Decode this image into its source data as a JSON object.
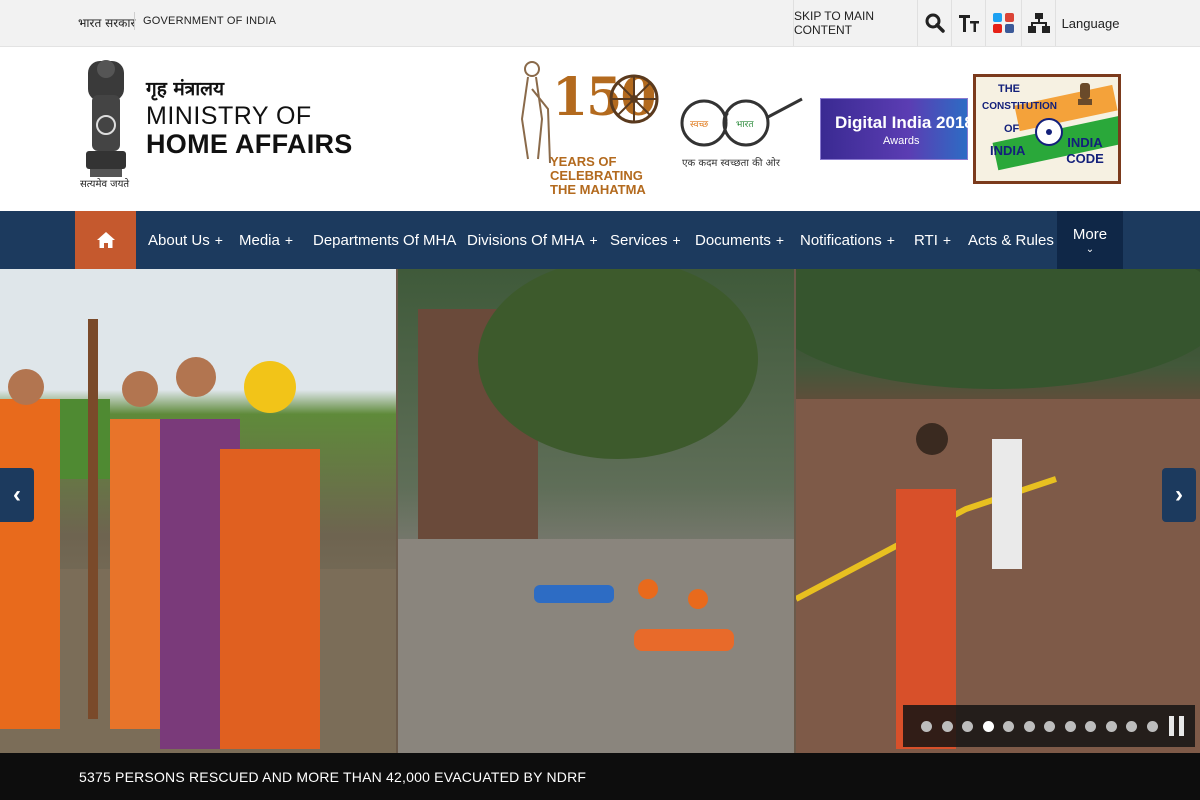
{
  "topbar": {
    "gov_hindi": "भारत सरकार",
    "gov_english": "GOVERNMENT OF INDIA",
    "skip_label": "SKIP TO MAIN CONTENT",
    "language_label": "Language"
  },
  "header": {
    "emblem_motto": "सत्यमेव जयते",
    "ministry_hindi": "गृह मंत्रालय",
    "ministry_line1": "MINISTRY OF",
    "ministry_line2": "HOME AFFAIRS",
    "gandhi_number": "150",
    "gandhi_caption": "YEARS OF CELEBRATING THE MAHATMA",
    "swachh_left": "स्वच्छ",
    "swachh_right": "भारत",
    "swachh_tagline": "एक कदम स्वच्छता की ओर",
    "digital_india": "Digital India 2018",
    "digital_awards": "Awards",
    "constitution_the": "THE",
    "constitution_name": "CONSTITUTION",
    "constitution_of": "OF",
    "constitution_india": "INDIA",
    "india_code": "INDIA CODE"
  },
  "nav": {
    "items": [
      {
        "label": "About Us",
        "plus": "+"
      },
      {
        "label": "Media",
        "plus": "+"
      },
      {
        "label": "Departments Of MHA",
        "plus": ""
      },
      {
        "label": "Divisions Of MHA",
        "plus": "+"
      },
      {
        "label": "Services",
        "plus": "+"
      },
      {
        "label": "Documents",
        "plus": "+"
      },
      {
        "label": "Notifications",
        "plus": "+"
      },
      {
        "label": "RTI",
        "plus": "+"
      },
      {
        "label": "Acts & Rules",
        "plus": ""
      }
    ],
    "more_label": "More"
  },
  "slider": {
    "dot_count": 12,
    "active_index": 3
  },
  "ticker": {
    "text": "5375 PERSONS RESCUED AND MORE THAN 42,000 EVACUATED BY NDRF"
  },
  "colors": {
    "nav_bg": "#1c3a5e",
    "home_bg": "#c5592e",
    "more_bg": "#0f2747",
    "ticker_bg": "#0d0d0d"
  }
}
